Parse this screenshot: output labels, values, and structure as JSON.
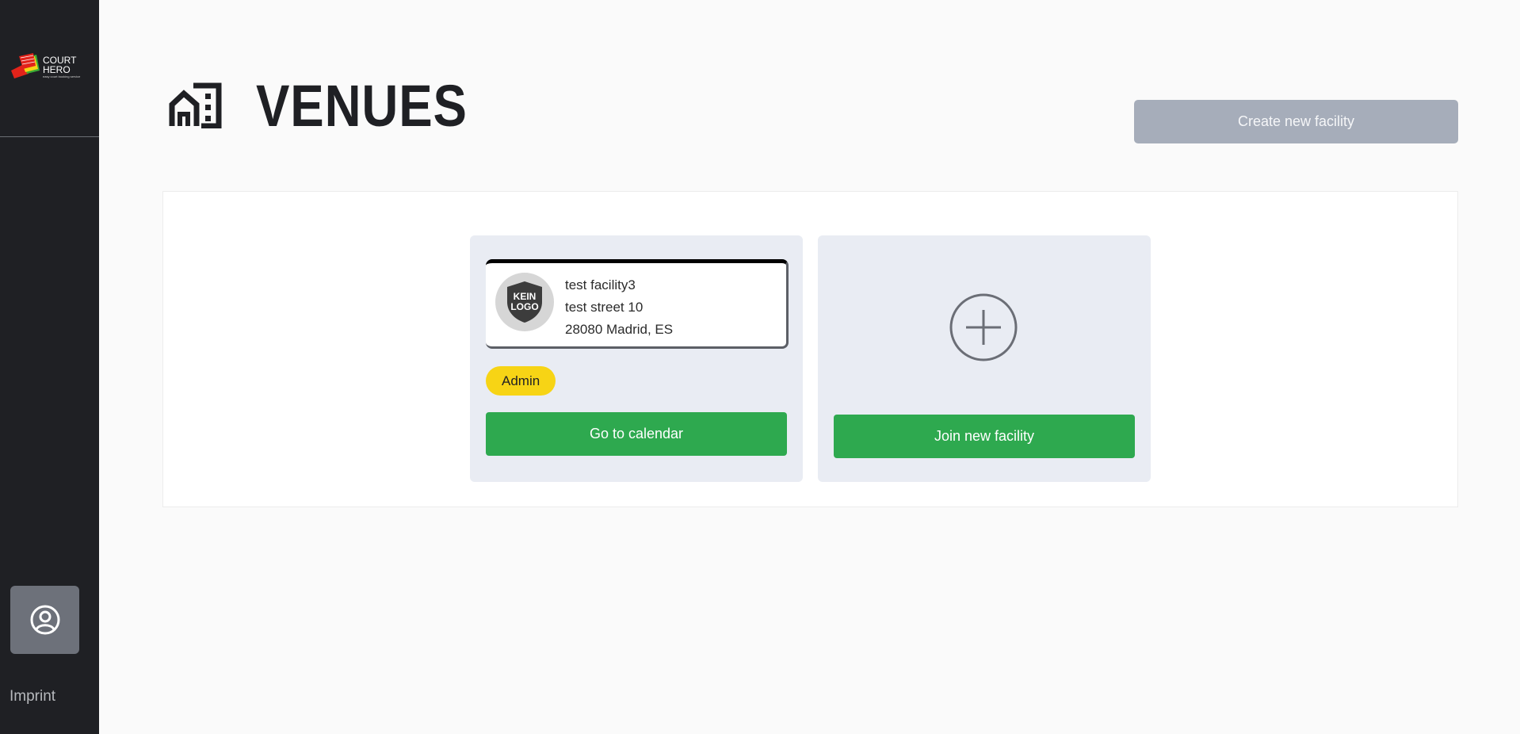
{
  "sidebar": {
    "logo": {
      "line1": "COURT",
      "line2": "HERO",
      "tagline": "easy court booking service",
      "colors": {
        "red": "#e2231a",
        "yellow": "#f7d415",
        "green": "#3aaa35"
      }
    },
    "profile_icon": "user-circle-icon",
    "imprint_label": "Imprint"
  },
  "header": {
    "icon": "buildings-icon",
    "title": "VENUES",
    "create_button_label": "Create new facility"
  },
  "facility_card": {
    "logo_text_line1": "KEIN",
    "logo_text_line2": "LOGO",
    "name": "test facility3",
    "street": "test street 10",
    "city": "28080 Madrid, ES",
    "role": "Admin",
    "calendar_button_label": "Go to calendar"
  },
  "join_card": {
    "icon": "plus-circle-icon",
    "join_button_label": "Join new facility"
  },
  "colors": {
    "sidebar_bg": "#1f2024",
    "accent_green": "#2ea94f",
    "badge_yellow": "#f7d415",
    "disabled_button": "#a6adba",
    "card_bg": "#e9ecf3"
  }
}
